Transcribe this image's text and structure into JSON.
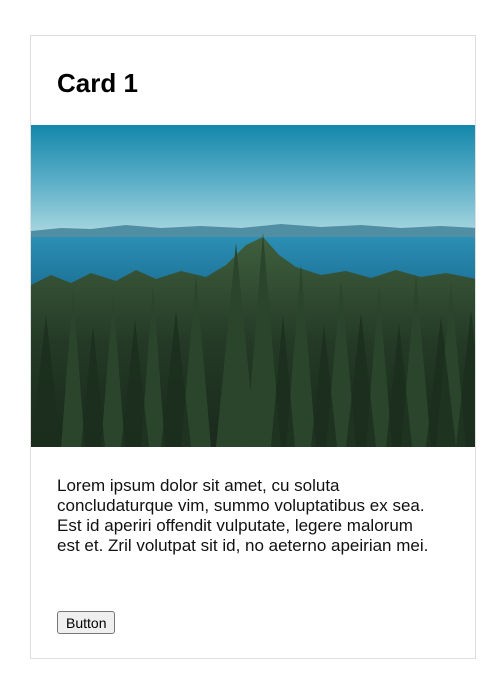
{
  "card": {
    "title": "Card 1",
    "image": {
      "description": "forest"
    },
    "text": "Lorem ipsum dolor sit amet, cu soluta concludaturque vim, summo voluptatibus ex sea. Est id aperiri offendit vulputate, legere malorum est et. Zril volutpat sit id, no aeterno apeirian mei.",
    "button_label": "Button"
  },
  "colors": {
    "sky_top": "#1a8fb0",
    "sky_bottom": "#8ec9d6",
    "sea": "#1f7fa6",
    "forest_dark": "#1f3322",
    "forest_mid": "#3a5a3a",
    "border": "#dedede"
  }
}
